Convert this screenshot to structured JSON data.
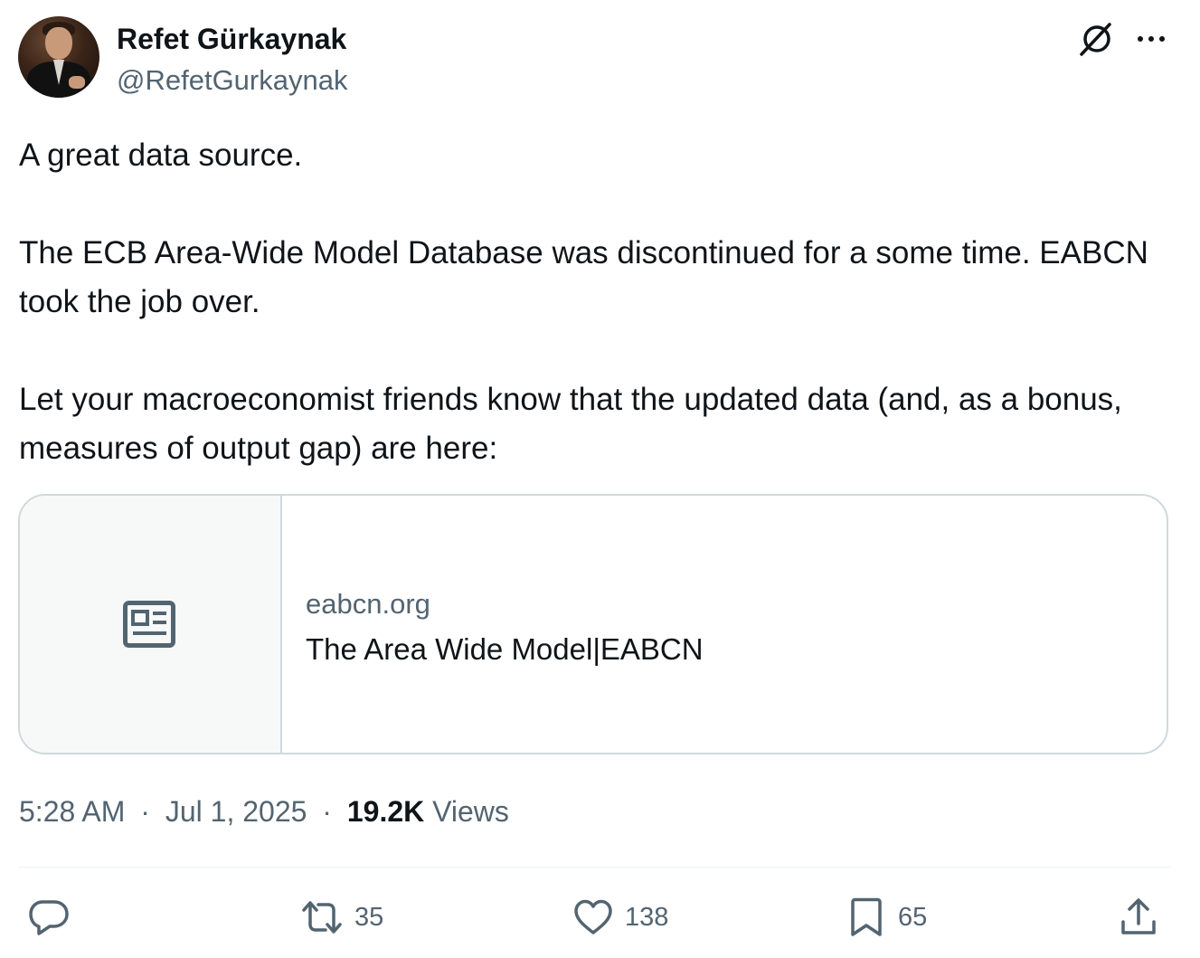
{
  "author": {
    "display_name": "Refet Gürkaynak",
    "handle": "@RefetGurkaynak"
  },
  "header_icons": [
    "grok-icon",
    "more-icon"
  ],
  "tweet": {
    "paragraphs": [
      "A great data source.",
      "The ECB Area-Wide Model Database was discontinued for a some time. EABCN took the job over.",
      "Let your macroeconomist friends know that the updated data (and, as a bonus, measures of output gap) are here:"
    ]
  },
  "link_card": {
    "icon": "article-icon",
    "domain": "eabcn.org",
    "title": "The Area Wide Model|EABCN"
  },
  "meta": {
    "time": "5:28 AM",
    "separator": "·",
    "date": "Jul 1, 2025",
    "views_count": "19.2K",
    "views_label": "Views"
  },
  "actions": {
    "reply": {
      "icon": "reply-icon",
      "count": ""
    },
    "repost": {
      "icon": "repost-icon",
      "count": "35"
    },
    "like": {
      "icon": "heart-icon",
      "count": "138"
    },
    "bookmark": {
      "icon": "bookmark-icon",
      "count": "65"
    },
    "share": {
      "icon": "share-icon",
      "count": ""
    }
  },
  "colors": {
    "text_primary": "#0f1419",
    "text_secondary": "#536471",
    "border": "#cfd9de",
    "card_thumb_bg": "#f7f9f9"
  }
}
